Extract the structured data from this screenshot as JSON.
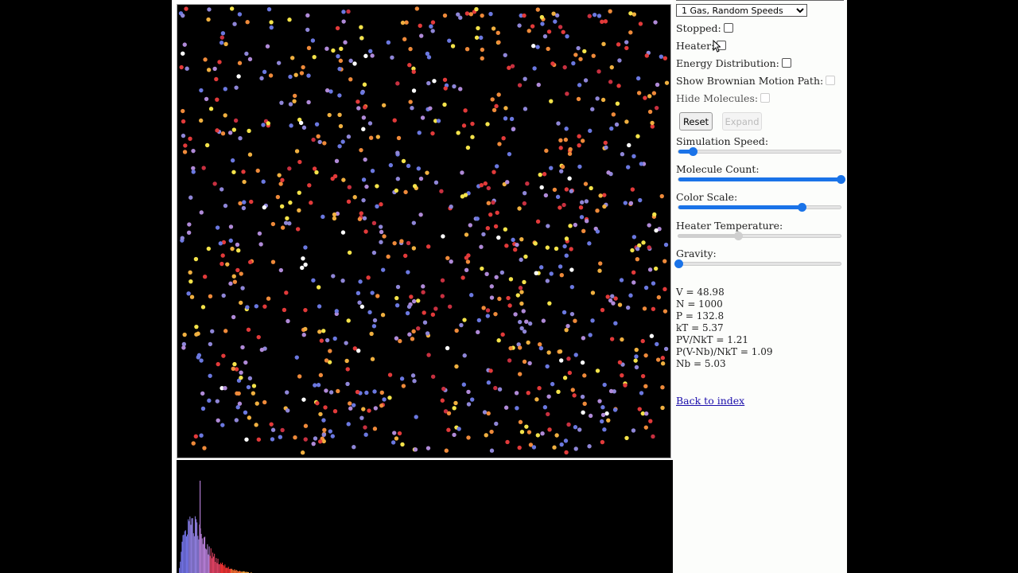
{
  "controls": {
    "mode_select": "1 Gas, Random Speeds",
    "stopped_label": "Stopped:",
    "heater_label": "Heater:",
    "energy_label": "Energy Distribution:",
    "brownian_label": "Show Brownian Motion Path:",
    "hide_label": "Hide Molecules:",
    "reset_label": "Reset",
    "expand_label": "Expand"
  },
  "sliders": {
    "speed": {
      "label": "Simulation Speed:",
      "value": 0.09
    },
    "count": {
      "label": "Molecule Count:",
      "value": 1.0
    },
    "color": {
      "label": "Color Scale:",
      "value": 0.76
    },
    "heater": {
      "label": "Heater Temperature:",
      "value": 0.37
    },
    "gravity": {
      "label": "Gravity:",
      "value": 0.0
    }
  },
  "stats": {
    "v": "V = 48.98",
    "n": "N = 1000",
    "p": "P = 132.8",
    "kt": "kT = 5.37",
    "pv": "PV/NkT = 1.21",
    "pvnb": "P(V-Nb)/NkT = 1.09",
    "nb": "Nb = 5.03"
  },
  "link": "Back to index",
  "colors": {
    "molecules": [
      "#6b78e0",
      "#8f86d8",
      "#b08ad8",
      "#e23a3a",
      "#c83040",
      "#ef8a3a",
      "#f0b040",
      "#f4e34a",
      "#ffffff"
    ],
    "slider": "#1a73e8"
  }
}
